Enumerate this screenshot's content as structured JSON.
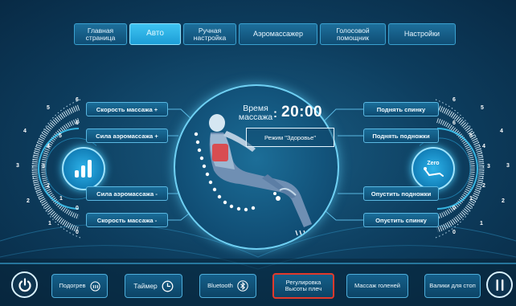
{
  "nav": {
    "tabs": [
      {
        "label_line1": "Главная",
        "label_line2": "страница"
      },
      {
        "label_line1": "Авто",
        "label_line2": ""
      },
      {
        "label_line1": "Ручная",
        "label_line2": "настройка"
      },
      {
        "label_line1": "Аэромассажер",
        "label_line2": ""
      },
      {
        "label_line1": "Голосовой",
        "label_line2": "помощник"
      },
      {
        "label_line1": "Настройки",
        "label_line2": ""
      }
    ],
    "active_tab": "Авто"
  },
  "left_panel": {
    "speed_up": "Скорость массажа +",
    "air_up": "Сила аэромассажа +",
    "air_down": "Сила аэромассажа -",
    "speed_down": "Скорость массажа -",
    "outer_numbers": [
      "6",
      "5",
      "4",
      "3",
      "2",
      "1",
      "0"
    ],
    "inner_numbers": [
      "6",
      "5",
      "4",
      "3",
      "2",
      "1",
      "0"
    ],
    "center_icon": "bars-level-icon"
  },
  "right_panel": {
    "back_up": "Поднять спинку",
    "legs_up": "Поднять подножки",
    "legs_down": "Опустить подножки",
    "back_down": "Опустить спинку",
    "outer_numbers": [
      "6",
      "5",
      "4",
      "3",
      "2",
      "1",
      "0"
    ],
    "inner_numbers": [
      "6",
      "5",
      "4",
      "3",
      "2",
      "1",
      "0"
    ],
    "center_icon": "zero-gravity-icon",
    "center_label": "Zero"
  },
  "center": {
    "time_label_line1": "Время",
    "time_label_line2": "массажа",
    "time_value": "20:00",
    "mode": "Режим \"Здоровье\""
  },
  "bottom_bar": {
    "heating": "Подогрев",
    "timer": "Таймер",
    "bluetooth": "Bluetooth",
    "shoulder_line1": "Регулировка",
    "shoulder_line2": "Высоты плеч",
    "calf": "Массаж голеней",
    "foot": "Валики для стоп"
  },
  "colors": {
    "accent": "#2eb8ec",
    "highlight_border": "#e2392b",
    "background": "#0d3d5e"
  }
}
